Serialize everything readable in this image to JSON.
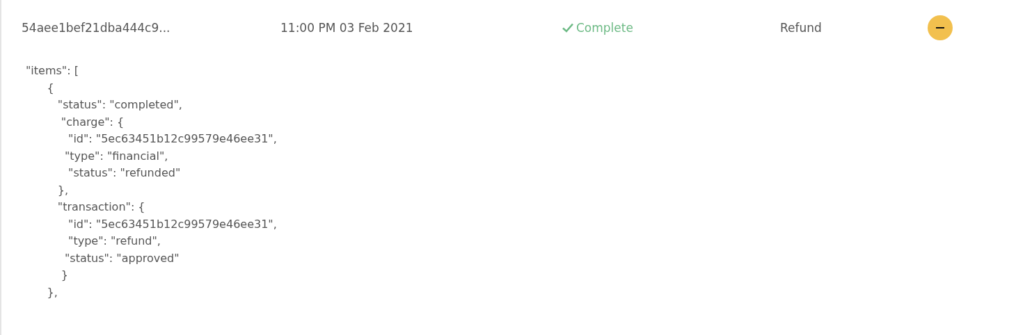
{
  "row": {
    "id": "54aee1bef21dba444c9...",
    "date": "11:00 PM 03 Feb 2021",
    "status": {
      "label": "Complete",
      "kind": "complete"
    },
    "type": "Refund",
    "expanded": true
  },
  "details": {
    "lines": [
      "\"items\": [",
      "      {",
      "         \"status\": \"completed\",",
      "          \"charge\": {",
      "            \"id\": \"5ec63451b12c99579e46ee31\",",
      "           \"type\": \"financial\",",
      "            \"status\": \"refunded\"",
      "         },",
      "         \"transaction\": {",
      "            \"id\": \"5ec63451b12c99579e46ee31\",",
      "            \"type\": \"refund\",",
      "           \"status\": \"approved\"",
      "          }",
      "      },"
    ]
  }
}
